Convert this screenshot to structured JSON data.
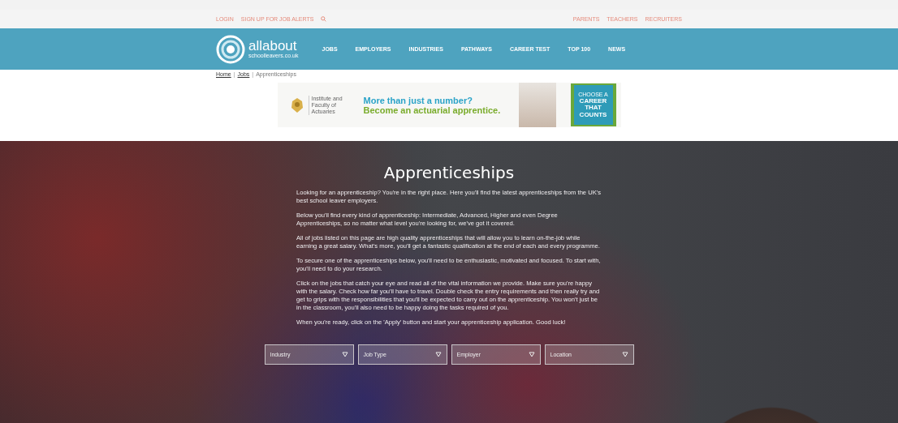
{
  "top_bar": {
    "left_links": [
      "LOGIN",
      "SIGN UP FOR JOB ALERTS"
    ],
    "right_links": [
      "PARENTS",
      "TEACHERS",
      "RECRUITERS"
    ]
  },
  "nav": {
    "logo": {
      "name": "allabout",
      "sub": "schoolleavers.co.uk"
    },
    "items": [
      "JOBS",
      "EMPLOYERS",
      "INDUSTRIES",
      "PATHWAYS",
      "CAREER TEST",
      "TOP 100",
      "NEWS"
    ]
  },
  "breadcrumb_separator": "|",
  "breadcrumb": [
    {
      "label": "Home",
      "link": true
    },
    {
      "label": "Jobs",
      "link": true
    },
    {
      "label": "Apprenticeships",
      "link": false
    }
  ],
  "banner": {
    "org": "Institute and Faculty of Actuaries",
    "headline": "More than just a number?",
    "subline": "Become an actuarial apprentice.",
    "badge_top": "CHOOSE A",
    "badge_lines": [
      "CAREER",
      "THAT",
      "COUNTS"
    ]
  },
  "hero": {
    "title": "Apprenticeships",
    "paragraphs": [
      "Looking for an apprenticeship? You're in the right place. Here you'll find the latest apprenticeships from the UK's best school leaver employers.",
      "Below you'll find every kind of apprenticeship: Intermediate, Advanced, Higher and even Degree Apprenticeships, so no matter what level you're looking for, we've got it covered.",
      "All of jobs listed on this page are high quality apprenticeships that will allow you to learn on-the-job while earning a great salary. What's more, you'll get a fantastic qualification at the end of each and every programme.",
      "To secure one of the apprenticeships below, you'll need to be enthusiastic, motivated and focused. To start with, you'll need to do your research.",
      "Click on the jobs that catch your eye and read all of the vital information we provide. Make sure you're happy with the salary. Check how far you'll have to travel. Double check the entry requirements and then really try and get to grips with the responsibilities that you'll be expected to carry out on the apprenticeship. You won't just be in the classroom, you'll also need to be happy doing the tasks required of you.",
      "When you're ready, click on the 'Apply' button and start your apprenticeship application. Good luck!"
    ],
    "filters": [
      "Industry",
      "Job Type",
      "Employer",
      "Location"
    ]
  }
}
